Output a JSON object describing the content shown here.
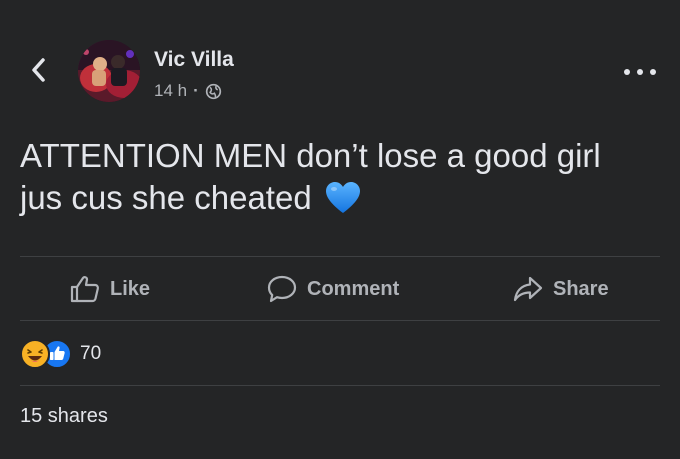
{
  "post": {
    "author": "Vic Villa",
    "time": "14 h",
    "separator": "·",
    "privacy_icon": "globe-icon",
    "text_line1": "ATTENTION MEN don’t lose a good girl",
    "text_line2": "jus cus she cheated",
    "emoji": "blue-heart-icon"
  },
  "actions": {
    "like": "Like",
    "comment": "Comment",
    "share": "Share"
  },
  "engagement": {
    "reaction_icons": [
      "haha-reaction-icon",
      "like-reaction-icon"
    ],
    "reaction_count": "70",
    "shares": "15 shares"
  },
  "colors": {
    "background": "#242526",
    "text_primary": "#e4e6eb",
    "text_secondary": "#b0b3b8",
    "divider": "#3e4042",
    "like_blue": "#1877f2",
    "haha_yellow": "#f7b125",
    "heart_blue": "#1b8cf0"
  }
}
